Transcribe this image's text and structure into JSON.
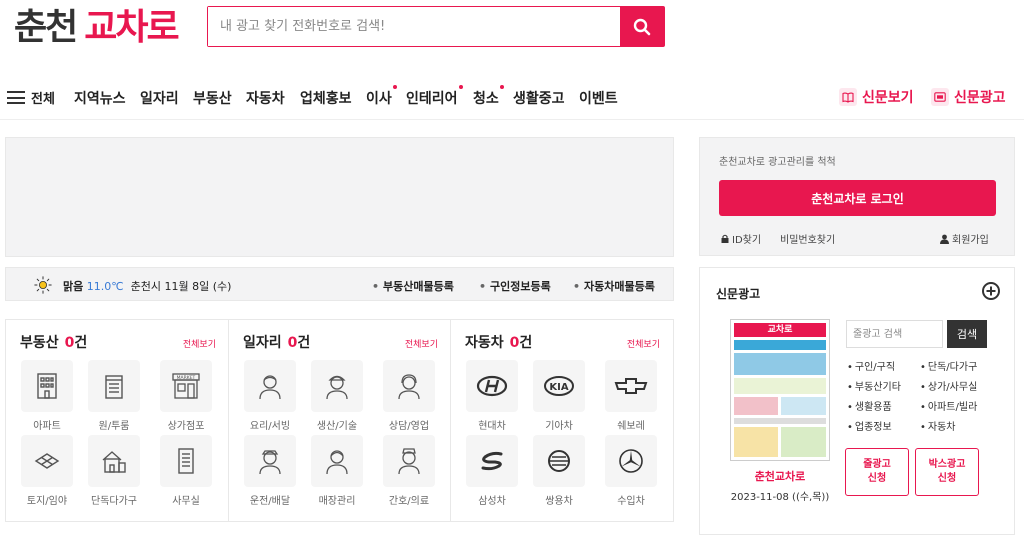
{
  "logo": {
    "part1": "춘천",
    "part2": "교차로"
  },
  "search": {
    "placeholder": "내 광고 찾기 전화번호로 검색!"
  },
  "nav": {
    "menu_label": "전체",
    "items": [
      "지역뉴스",
      "일자리",
      "부동산",
      "자동차",
      "업체홍보",
      "이사",
      "인테리어",
      "청소",
      "생활중고",
      "이벤트"
    ],
    "right": [
      "신문보기",
      "신문광고"
    ]
  },
  "weather": {
    "condition": "맑음",
    "temp": "11.0℃",
    "date": "춘천시 11월 8일 (수)",
    "links": [
      "부동산매물등록",
      "구인정보등록",
      "자동차매물등록"
    ]
  },
  "categories": [
    {
      "title": "부동산",
      "count": "0",
      "unit": "건",
      "more": "전체보기",
      "items": [
        "아파트",
        "원/투룸",
        "상가점포",
        "토지/임야",
        "단독다가구",
        "사무실"
      ]
    },
    {
      "title": "일자리",
      "count": "0",
      "unit": "건",
      "more": "전체보기",
      "items": [
        "요리/서빙",
        "생산/기술",
        "상담/영업",
        "운전/배달",
        "매장관리",
        "간호/의료"
      ]
    },
    {
      "title": "자동차",
      "count": "0",
      "unit": "건",
      "more": "전체보기",
      "items": [
        "현대차",
        "기아차",
        "쉐보레",
        "삼성차",
        "쌍용차",
        "수입차"
      ]
    }
  ],
  "login": {
    "hint": "춘천교차로 광고관리를 척척",
    "button": "춘천교차로 로그인",
    "find_id": "ID찾기",
    "find_pw": "비밀번호찾기",
    "join": "회원가입"
  },
  "paper": {
    "title": "신문광고",
    "name": "춘천교차로",
    "date": "2023-11-08 ((수,목))",
    "cover_brand": "교차로",
    "search_placeholder": "줄광고 검색",
    "search_button": "검색",
    "cats": [
      "구인/구직",
      "단독/다가구",
      "부동산기타",
      "상가/사무실",
      "생활용품",
      "아파트/빌라",
      "업종정보",
      "자동차"
    ],
    "apply_line": "줄광고\n신청",
    "apply_box": "박스광고\n신청"
  },
  "colors": {
    "accent": "#e8174f",
    "temp": "#3a7bd5"
  }
}
